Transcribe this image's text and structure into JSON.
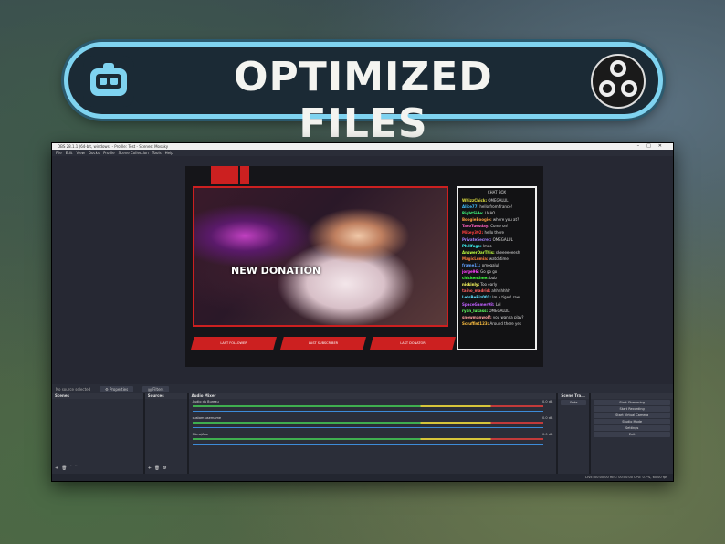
{
  "banner": {
    "title": "OPTIMIZED FILES",
    "left_logo": "streamlabs-icon",
    "right_logo": "obs-icon"
  },
  "window": {
    "title": "OBS 28.1.1 (64-bit, windows) - Profile: Test - Scenes: Mosaky",
    "menu": [
      "File",
      "Edit",
      "View",
      "Docks",
      "Profile",
      "Scene Collection",
      "Tools",
      "Help"
    ]
  },
  "scene": {
    "alert_text": "NEW DONATION",
    "chat_header": "CHAT BOX",
    "chat": [
      {
        "user": "WhizzChick:",
        "msg": "OMEGALUL",
        "color": "#e0e040"
      },
      {
        "user": "Alice77:",
        "msg": "hello from france!",
        "color": "#40c0ff"
      },
      {
        "user": "RightSide:",
        "msg": "LMAO",
        "color": "#40ff80"
      },
      {
        "user": "BoogieBoogie:",
        "msg": "where you at?",
        "color": "#ffa040"
      },
      {
        "user": "TacoTuesday:",
        "msg": "Come on!",
        "color": "#ff60c0"
      },
      {
        "user": "Mikey392:",
        "msg": "hello there",
        "color": "#ff4040"
      },
      {
        "user": "PrivateSecret:",
        "msg": "OMEGALUL",
        "color": "#a080ff"
      },
      {
        "user": "Phillfoge:",
        "msg": "lmao",
        "color": "#40ffff"
      },
      {
        "user": "AnswerDarThis:",
        "msg": "sheeeeeeesh",
        "color": "#c0ff40"
      },
      {
        "user": "MagicLumia:",
        "msg": "watchtime",
        "color": "#ff8040"
      },
      {
        "user": "frame11:",
        "msg": "omegalul",
        "color": "#60a0ff"
      },
      {
        "user": "jorge96:",
        "msg": "Go go go",
        "color": "#ff40ff"
      },
      {
        "user": "chickentime:",
        "msg": "bub",
        "color": "#40ff40"
      },
      {
        "user": "nickinly:",
        "msg": "Too early",
        "color": "#ffff60"
      },
      {
        "user": "taino_madrid:",
        "msg": "ahhhhhhh",
        "color": "#ff6060"
      },
      {
        "user": "LetsBeBiz001:",
        "msg": "Im a tiger! raw!",
        "color": "#60e0ff"
      },
      {
        "user": "SpaceGamer98:",
        "msg": "Lol",
        "color": "#c060ff"
      },
      {
        "user": "ryan_lukass:",
        "msg": "OMEGALUL",
        "color": "#60ff60"
      },
      {
        "user": "snowmanwolf:",
        "msg": "you wanna play?",
        "color": "#ffa0a0"
      },
      {
        "user": "Scruffint123:",
        "msg": "Around there yes",
        "color": "#ffc040"
      }
    ],
    "bars": [
      "LAST FOLLOWER",
      "LAST SUBSCRIBER",
      "LAST DONATOR"
    ]
  },
  "toolbar": {
    "no_source": "No source selected",
    "properties": "Properties",
    "filters": "Filters"
  },
  "docks": {
    "scenes": "Scenes",
    "sources": "Sources",
    "audio_mixer": "Audio Mixer",
    "scene_transitions": "Scene Tra...",
    "controls": [
      "Start Streaming",
      "Start Recording",
      "Start Virtual Camera",
      "Studio Mode",
      "Settings",
      "Exit"
    ],
    "tracks": [
      {
        "name": "Audio du Bureau",
        "db": "0.0 dB"
      },
      {
        "name": "custom username",
        "db": "0.0 dB"
      },
      {
        "name": "Micro/Aux",
        "db": "0.0 dB"
      }
    ],
    "transition": "Fade"
  },
  "status": "LIVE: 00:00:00    REC: 00:00:00    CPU: 0.7%, 60.00 fps"
}
